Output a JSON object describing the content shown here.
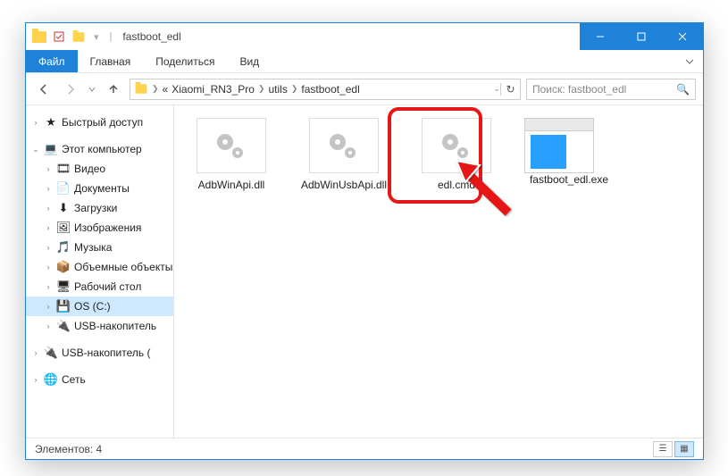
{
  "titlebar": {
    "title": "fastboot_edl"
  },
  "ribbon": {
    "file": "Файл",
    "home": "Главная",
    "share": "Поделиться",
    "view": "Вид"
  },
  "breadcrumb": {
    "root_hint": "«",
    "p1": "Xiaomi_RN3_Pro",
    "p2": "utils",
    "p3": "fastboot_edl"
  },
  "search": {
    "placeholder": "Поиск: fastboot_edl"
  },
  "sidebar": {
    "quick": "Быстрый доступ",
    "pc": "Этот компьютер",
    "video": "Видео",
    "docs": "Документы",
    "down": "Загрузки",
    "pics": "Изображения",
    "music": "Музыка",
    "vol": "Объемные объекты",
    "desk": "Рабочий стол",
    "os": "OS (C:)",
    "usb1": "USB-накопитель",
    "usb2": "USB-накопитель (",
    "net": "Сеть"
  },
  "files": {
    "f1": "AdbWinApi.dll",
    "f2": "AdbWinUsbApi.dll",
    "f3": "edl.cmd",
    "f4": "fastboot_edl.exe"
  },
  "status": {
    "count": "Элементов: 4"
  }
}
